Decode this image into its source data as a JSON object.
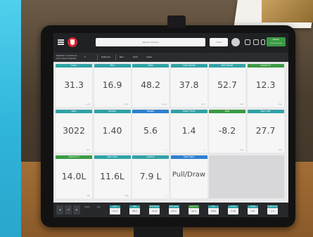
{
  "topbar": {
    "search_text": "tap for practice",
    "club_text": "7 Iron",
    "ready_label": "Ready",
    "ready_sub": "Trackman Indoor"
  },
  "toolbar": {
    "weather_line1": "Weather Conditions",
    "weather_line2": "Set Indoor/Outdoor",
    "items": [
      "T",
      "Multi-pin",
      "Ball",
      "Shot",
      "Label"
    ]
  },
  "tiles": [
    {
      "label": "Carry",
      "value": "31.3",
      "unit": "y yds",
      "color": "teal"
    },
    {
      "label": "Roll",
      "value": "16.9",
      "unit": "y yds",
      "color": "teal"
    },
    {
      "label": "Total",
      "value": "48.2",
      "unit": "y yds",
      "color": "teal"
    },
    {
      "label": "Club Speed",
      "value": "37.8",
      "unit": "mph",
      "color": "teal"
    },
    {
      "label": "Ball Speed",
      "value": "52.7",
      "unit": "mph",
      "color": "teal"
    },
    {
      "label": "Launch V",
      "value": "12.3",
      "unit": "deg",
      "color": "green"
    },
    {
      "label": "Spin",
      "value": "3022",
      "unit": "rpm",
      "color": "teal"
    },
    {
      "label": "Smash",
      "value": "1.40",
      "unit": "",
      "color": "teal"
    },
    {
      "label": "Height",
      "value": "5.6",
      "unit": "y",
      "color": "blue"
    },
    {
      "label": "Flight Time",
      "value": "1.4",
      "unit": "s",
      "color": "teal"
    },
    {
      "label": "AOA",
      "value": "-8.2",
      "unit": "deg",
      "color": "green"
    },
    {
      "label": "Spin Loft",
      "value": "27.7",
      "unit": "deg",
      "color": "teal"
    },
    {
      "label": "Launch H",
      "value": "14.0L",
      "unit": "deg",
      "color": "green"
    },
    {
      "label": "Spin Axis",
      "value": "11.6L",
      "unit": "deg",
      "color": "teal"
    },
    {
      "label": "Lateral",
      "value": "7.9 L",
      "unit": "y",
      "color": "teal"
    },
    {
      "label": "Shot Type",
      "value": "Pull/Draw",
      "unit": "",
      "color": "blue"
    }
  ],
  "bottom": {
    "nav": [
      "◀",
      "10",
      "▶"
    ],
    "labels": [
      "Shots",
      "Avg"
    ],
    "cells": [
      {
        "label": "Carry",
        "value": "31.3",
        "color": "teal"
      },
      {
        "label": "Total",
        "value": "48.2",
        "color": "teal"
      },
      {
        "label": "Club Speed",
        "value": "37.8",
        "color": "teal"
      },
      {
        "label": "Ball Speed",
        "value": "52.7",
        "color": "teal"
      },
      {
        "label": "Launch V",
        "value": "12.3",
        "color": "green"
      },
      {
        "label": "Spin",
        "value": "3022",
        "color": "teal"
      },
      {
        "label": "Smash",
        "value": "1.40",
        "color": "teal"
      },
      {
        "label": "Height",
        "value": "5.6",
        "color": "teal"
      },
      {
        "label": "Flight Time",
        "value": "1.4",
        "color": "teal"
      }
    ]
  },
  "colors": {
    "teal": "#2fa2a6",
    "blue": "#2f7fd0",
    "green": "#3a9a44"
  }
}
